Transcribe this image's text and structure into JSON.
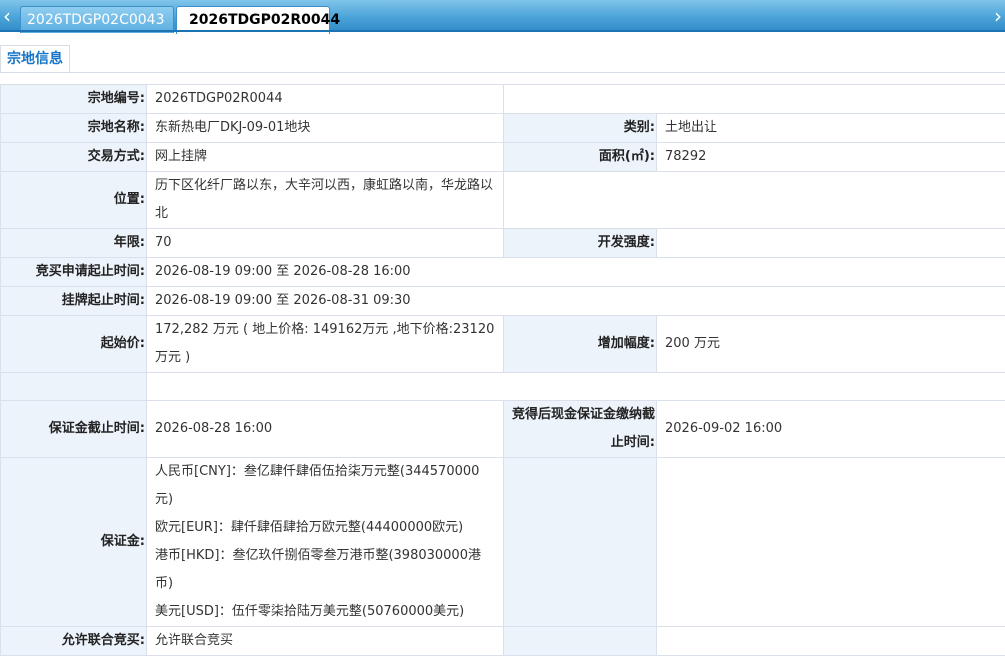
{
  "tabs": [
    {
      "label": "2026TDGP02C0043",
      "active": false
    },
    {
      "label": "2026TDGP02R0044",
      "active": true
    }
  ],
  "subtab": {
    "label": "宗地信息"
  },
  "icons": {
    "left_arrow": "chevron-left-icon",
    "right_arrow": "chevron-right-icon"
  },
  "fields": {
    "parcel_no": {
      "label": "宗地编号:",
      "value": "2026TDGP02R0044"
    },
    "parcel_name": {
      "label": "宗地名称:",
      "value": "东新热电厂DKJ-09-01地块"
    },
    "category": {
      "label": "类别:",
      "value": "土地出让"
    },
    "trade_method": {
      "label": "交易方式:",
      "value": "网上挂牌"
    },
    "area": {
      "label": "面积(㎡):",
      "value": "78292"
    },
    "location": {
      "label": "位置:",
      "value": "历下区化纤厂路以东，大辛河以西，康虹路以南，华龙路以北"
    },
    "term": {
      "label": "年限:",
      "value": "70"
    },
    "dev_intensity": {
      "label": "开发强度:",
      "value": ""
    },
    "apply_period": {
      "label": "竞买申请起止时间:",
      "value": "2026-08-19 09:00 至 2026-08-28 16:00"
    },
    "listing_period": {
      "label": "挂牌起止时间:",
      "value": "2026-08-19 09:00 至 2026-08-31 09:30"
    },
    "start_price": {
      "label": "起始价:",
      "value": "172,282 万元 ( 地上价格: 149162万元 ,地下价格:23120万元 )"
    },
    "increment": {
      "label": "增加幅度:",
      "value": "200 万元"
    },
    "deposit_deadline": {
      "label": "保证金截止时间:",
      "value": "2026-08-28 16:00"
    },
    "cash_deposit_deadline": {
      "label": "竞得后现金保证金缴纳截止时间:",
      "value": "2026-09-02 16:00"
    },
    "deposit": {
      "label": "保证金:",
      "lines": [
        "人民币[CNY]：叁亿肆仟肆佰伍拾柒万元整(344570000元)",
        "欧元[EUR]：肆仟肆佰肆拾万欧元整(44400000欧元)",
        "港币[HKD]：叁亿玖仟捌佰零叁万港币整(398030000港币)",
        "美元[USD]：伍仟零柒拾陆万美元整(50760000美元)"
      ]
    },
    "joint_bid": {
      "label": "允许联合竞买:",
      "value": "允许联合竞买"
    }
  }
}
